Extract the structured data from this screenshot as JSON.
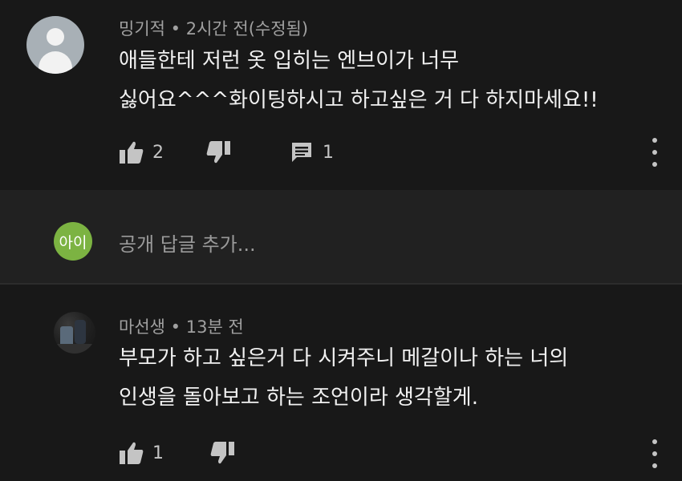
{
  "comments": [
    {
      "author": "밍기적",
      "time": "2시간 전(수정됨)",
      "lines": [
        "애들한테 저런 옷 입히는 엔브이가 너무",
        "싫어요^^^화이팅하시고 하고싶은 거 다 하지마세요!!"
      ],
      "likes": "2",
      "replies": "1"
    },
    {
      "author": "마선생",
      "time": "13분 전",
      "lines": [
        "부모가 하고 싶은거 다 시켜주니 메갈이나 하는 너의",
        "인생을 돌아보고 하는 조언이라 생각할게."
      ],
      "likes": "1"
    }
  ],
  "reply_box": {
    "avatar_text": "아이",
    "placeholder": "공개 답글 추가..."
  },
  "icons": {
    "like": "thumbs-up-icon",
    "dislike": "thumbs-down-icon",
    "reply": "comment-icon",
    "more": "more-vertical-icon"
  },
  "colors": {
    "background": "#181818",
    "reply_background": "#212121",
    "user_avatar": "#7cb342"
  }
}
